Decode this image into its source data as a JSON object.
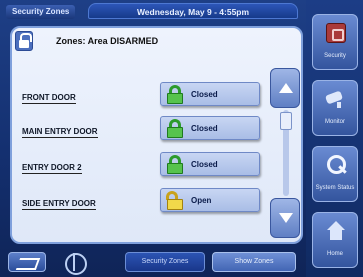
{
  "header": {
    "title": "Security Zones",
    "datetime": "Wednesday, May 9 - 4:55pm"
  },
  "panel": {
    "title": "Zones: Area DISARMED",
    "zones": [
      {
        "name": "FRONT DOOR",
        "status": "Closed",
        "icon": "closed-lock-icon"
      },
      {
        "name": "MAIN ENTRY DOOR",
        "status": "Closed",
        "icon": "closed-lock-icon"
      },
      {
        "name": "ENTRY DOOR 2",
        "status": "Closed",
        "icon": "closed-lock-icon"
      },
      {
        "name": "SIDE ENTRY DOOR",
        "status": "Open",
        "icon": "open-lock-icon"
      }
    ]
  },
  "bottombar": {
    "tab_security": "Security Zones",
    "tab_show": "Show Zones"
  },
  "sidebar": {
    "items": [
      {
        "label": "Security",
        "icon": "security-icon"
      },
      {
        "label": "Monitor",
        "icon": "camera-icon"
      },
      {
        "label": "System Status",
        "icon": "magnifier-icon"
      },
      {
        "label": "Home",
        "icon": "home-icon"
      }
    ]
  },
  "colors": {
    "closed": "#56c34d",
    "open": "#f1d94a",
    "accent": "#1e3f86"
  }
}
